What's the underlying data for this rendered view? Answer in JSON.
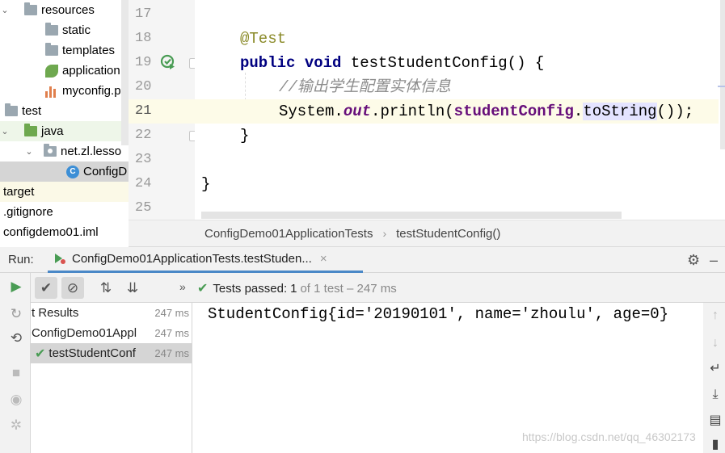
{
  "project_tree": {
    "items": [
      {
        "label": "resources",
        "arrow": "⌄",
        "icon": "resources-folder-icon"
      },
      {
        "label": "static",
        "icon": "folder-icon"
      },
      {
        "label": "templates",
        "icon": "folder-icon"
      },
      {
        "label": "application",
        "icon": "spring-properties-icon"
      },
      {
        "label": "myconfig.p",
        "icon": "properties-file-icon"
      },
      {
        "label": "test",
        "icon": "folder-icon"
      },
      {
        "label": "java",
        "arrow": "⌄",
        "icon": "test-sources-folder-icon"
      },
      {
        "label": "net.zl.lesso",
        "arrow": "⌄",
        "icon": "package-icon"
      },
      {
        "label": "ConfigD",
        "icon": "class-icon"
      },
      {
        "label": "target"
      },
      {
        "label": ".gitignore"
      },
      {
        "label": "configdemo01.iml"
      }
    ]
  },
  "editor": {
    "line_numbers": [
      "17",
      "18",
      "19",
      "20",
      "21",
      "22",
      "23",
      "24",
      "25"
    ],
    "current_line": "21",
    "code": {
      "l18_annotation": "@Test",
      "l19_kw1": "public",
      "l19_kw2": "void",
      "l19_rest": " testStudentConfig() {",
      "l20_comment": "//输出学生配置实体信息",
      "l21_sys": "System.",
      "l21_out": "out",
      "l21_println": ".println(",
      "l21_field": "studentConfig",
      "l21_dot": ".",
      "l21_method": "toString",
      "l21_end": "());",
      "l22": "}",
      "l24": "}"
    }
  },
  "breadcrumb": {
    "class_name": "ConfigDemo01ApplicationTests",
    "separator": "›",
    "method_name": "testStudentConfig()"
  },
  "run_panel": {
    "label": "Run:",
    "tab_title": "ConfigDemo01ApplicationTests.testStuden...",
    "tab_close": "×",
    "status": {
      "more": "»",
      "label": "Tests passed:",
      "passed": "1",
      "rest": "of 1 test – 247 ms"
    },
    "results": [
      {
        "name": "t Results",
        "time": "247 ms"
      },
      {
        "name": "ConfigDemo01Appl",
        "time": "247 ms"
      },
      {
        "name": "testStudentConf",
        "time": "247 ms",
        "check": "✔"
      }
    ],
    "console_output": "StudentConfig{id='20190101', name='zhoulu', age=0}"
  },
  "watermark": "https://blog.csdn.net/qq_46302173",
  "colors": {
    "pass": "#499c54",
    "tab_underline": "#4a88c7",
    "keyword": "#000080",
    "field": "#660e7a",
    "annotation": "#8b8b2a"
  }
}
